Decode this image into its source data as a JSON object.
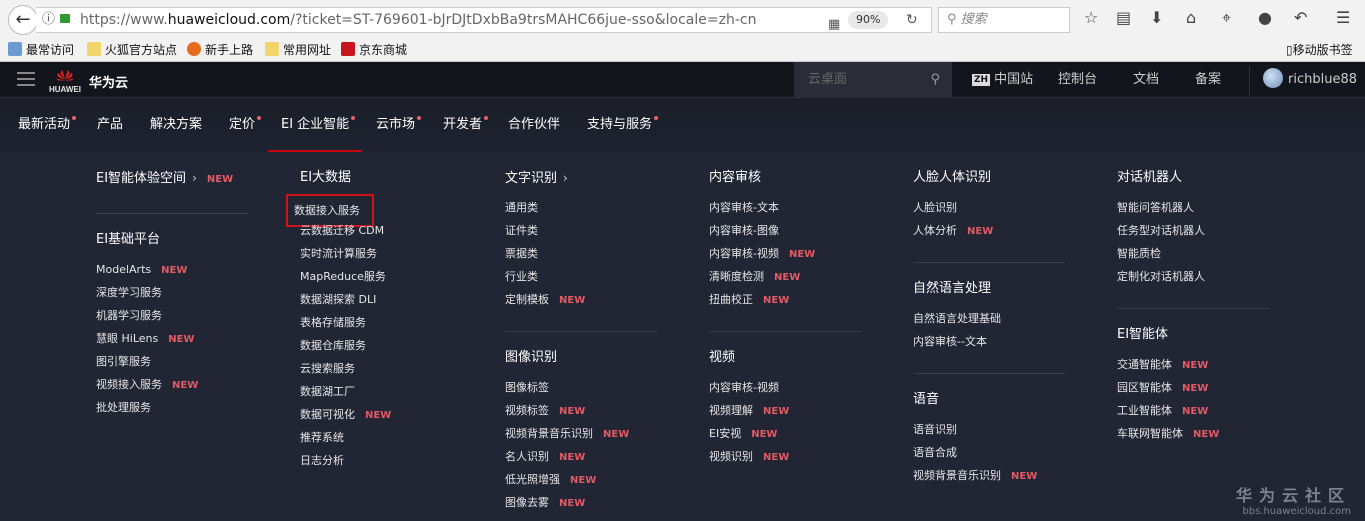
{
  "browser": {
    "url_prefix": "https://www.",
    "url_domain": "huaweicloud.com",
    "url_rest": "/?ticket=ST-769601-bJrDJtDxbBa9trsMAHC66jue-sso&locale=zh-cn",
    "zoom": "90%",
    "search_placeholder": "搜索",
    "bookmarks": [
      "最常访问",
      "火狐官方站点",
      "新手上路",
      "常用网址",
      "京东商城"
    ],
    "mobile_bookmarks": "移动版书签"
  },
  "header": {
    "brand": "华为云",
    "logo_text": "HUAWEI",
    "search_placeholder": "云桌面",
    "region_badge": "ZH",
    "region": "中国站",
    "console": "控制台",
    "docs": "文档",
    "icp": "备案",
    "user": "richblue88"
  },
  "nav": [
    {
      "label": "最新活动",
      "dot": true
    },
    {
      "label": "产品",
      "dot": false
    },
    {
      "label": "解决方案",
      "dot": false
    },
    {
      "label": "定价",
      "dot": true
    },
    {
      "label": "EI 企业智能",
      "dot": true,
      "active": true
    },
    {
      "label": "云市场",
      "dot": true
    },
    {
      "label": "开发者",
      "dot": true
    },
    {
      "label": "合作伙伴",
      "dot": false
    },
    {
      "label": "支持与服务",
      "dot": true
    }
  ],
  "new_label": "NEW",
  "columns": [
    [
      {
        "title": "EI智能体验空间",
        "arrow": true,
        "new": true,
        "items": []
      },
      {
        "title": "EI基础平台",
        "items": [
          {
            "label": "ModelArts",
            "new": true
          },
          {
            "label": "深度学习服务"
          },
          {
            "label": "机器学习服务"
          },
          {
            "label": "慧眼 HiLens",
            "new": true
          },
          {
            "label": "图引擎服务"
          },
          {
            "label": "视频接入服务",
            "new": true
          },
          {
            "label": "批处理服务"
          }
        ]
      }
    ],
    [
      {
        "title": "EI大数据",
        "items": [
          {
            "label": "数据接入服务",
            "highlighted": true
          },
          {
            "label": "云数据迁移 CDM"
          },
          {
            "label": "实时流计算服务"
          },
          {
            "label": "MapReduce服务"
          },
          {
            "label": "数据湖探索 DLI"
          },
          {
            "label": "表格存储服务"
          },
          {
            "label": "数据仓库服务"
          },
          {
            "label": "云搜索服务"
          },
          {
            "label": "数据湖工厂"
          },
          {
            "label": "数据可视化",
            "new": true
          },
          {
            "label": "推荐系统"
          },
          {
            "label": "日志分析"
          }
        ]
      }
    ],
    [
      {
        "title": "文字识别",
        "arrow": true,
        "items": [
          {
            "label": "通用类"
          },
          {
            "label": "证件类"
          },
          {
            "label": "票据类"
          },
          {
            "label": "行业类"
          },
          {
            "label": "定制模板",
            "new": true
          }
        ]
      },
      {
        "title": "图像识别",
        "items": [
          {
            "label": "图像标签"
          },
          {
            "label": "视频标签",
            "new": true
          },
          {
            "label": "视频背景音乐识别",
            "new": true
          },
          {
            "label": "名人识别",
            "new": true
          },
          {
            "label": "低光照增强",
            "new": true
          },
          {
            "label": "图像去雾",
            "new": true
          }
        ]
      }
    ],
    [
      {
        "title": "内容审核",
        "items": [
          {
            "label": "内容审核-文本"
          },
          {
            "label": "内容审核-图像"
          },
          {
            "label": "内容审核-视频",
            "new": true
          },
          {
            "label": "清晰度检测",
            "new": true
          },
          {
            "label": "扭曲校正",
            "new": true
          }
        ]
      },
      {
        "title": "视频",
        "items": [
          {
            "label": "内容审核-视频"
          },
          {
            "label": "视频理解",
            "new": true
          },
          {
            "label": "EI安视",
            "new": true
          },
          {
            "label": "视频识别",
            "new": true
          }
        ]
      }
    ],
    [
      {
        "title": "人脸人体识别",
        "items": [
          {
            "label": "人脸识别"
          },
          {
            "label": "人体分析",
            "new": true
          }
        ]
      },
      {
        "title": "自然语言处理",
        "items": [
          {
            "label": "自然语言处理基础"
          },
          {
            "label": "内容审核--文本"
          }
        ]
      },
      {
        "title": "语音",
        "items": [
          {
            "label": "语音识别"
          },
          {
            "label": "语音合成"
          },
          {
            "label": "视频背景音乐识别",
            "new": true
          }
        ]
      }
    ],
    [
      {
        "title": "对话机器人",
        "items": [
          {
            "label": "智能问答机器人"
          },
          {
            "label": "任务型对话机器人"
          },
          {
            "label": "智能质检"
          },
          {
            "label": "定制化对话机器人"
          }
        ]
      },
      {
        "title": "EI智能体",
        "items": [
          {
            "label": "交通智能体",
            "new": true
          },
          {
            "label": "园区智能体",
            "new": true
          },
          {
            "label": "工业智能体",
            "new": true
          },
          {
            "label": "车联网智能体",
            "new": true
          }
        ]
      }
    ]
  ],
  "watermark": {
    "title": "华为云社区",
    "url": "bbs.huaweicloud.com"
  }
}
